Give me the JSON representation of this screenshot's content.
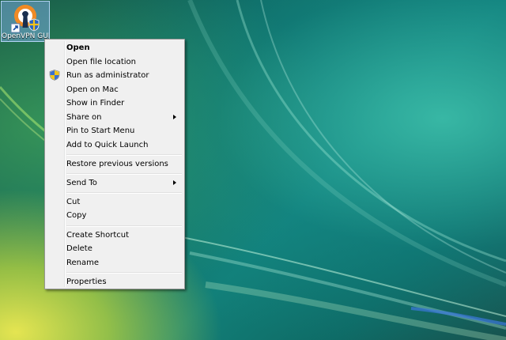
{
  "desktop": {
    "icon": {
      "label": "OpenVPN GUI",
      "icon_name": "openvpn-shortcut-icon"
    }
  },
  "context_menu": {
    "items": [
      {
        "label": "Open",
        "bold": true
      },
      {
        "label": "Open file location"
      },
      {
        "label": "Run as administrator",
        "icon": "uac-shield-icon"
      },
      {
        "label": "Open on Mac"
      },
      {
        "label": "Show in Finder"
      },
      {
        "label": "Share on",
        "submenu": true
      },
      {
        "label": "Pin to Start Menu"
      },
      {
        "label": "Add to Quick Launch"
      },
      {
        "label": "Restore previous versions"
      },
      {
        "label": "Send To",
        "submenu": true
      },
      {
        "label": "Cut"
      },
      {
        "label": "Copy"
      },
      {
        "label": "Create Shortcut"
      },
      {
        "label": "Delete"
      },
      {
        "label": "Rename"
      },
      {
        "label": "Properties"
      }
    ]
  }
}
